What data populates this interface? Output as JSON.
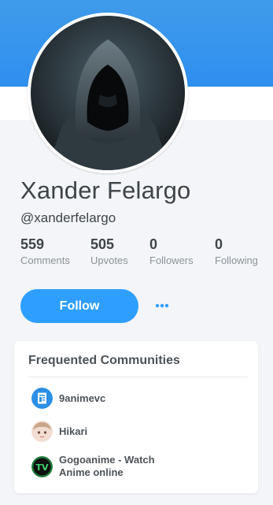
{
  "profile": {
    "name": "Xander Felargo",
    "handle": "@xanderfelargo"
  },
  "stats": [
    {
      "value": "559",
      "label": "Comments"
    },
    {
      "value": "505",
      "label": "Upvotes"
    },
    {
      "value": "0",
      "label": "Followers"
    },
    {
      "value": "0",
      "label": "Following"
    }
  ],
  "actions": {
    "follow_label": "Follow",
    "more_icon": "more-dots-icon"
  },
  "communities": {
    "title": "Frequented Communities",
    "items": [
      {
        "name": "9animevc",
        "icon": "document-icon"
      },
      {
        "name": "Hikari",
        "icon": "anime-avatar-icon"
      },
      {
        "name_line1": "Gogoanime - Watch",
        "name_line2": "Anime online",
        "icon": "tv-logo-icon"
      }
    ]
  },
  "colors": {
    "accent": "#2e9fff",
    "cover": "#3f9bea",
    "text": "#3e4449",
    "muted": "#8b9399"
  }
}
